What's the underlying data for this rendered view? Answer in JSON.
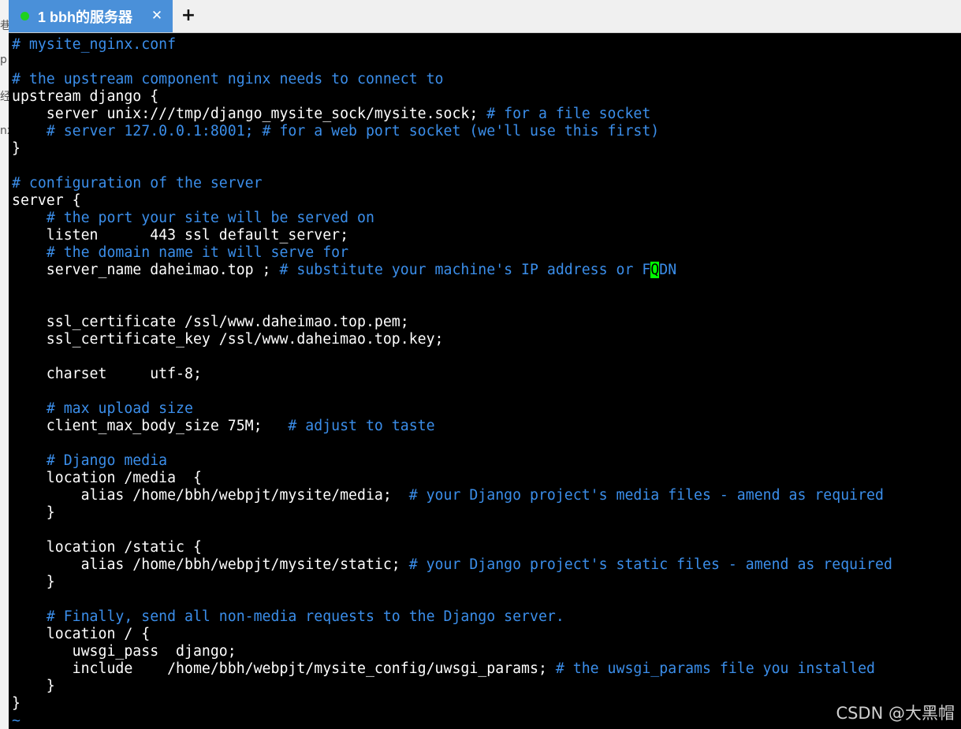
{
  "window": {
    "tab": {
      "label": "1 bbh的服务器",
      "status_color": "#1fd11f",
      "close_icon": "close-icon"
    },
    "new_tab_label": "+"
  },
  "terminal": {
    "lines": [
      {
        "code": "",
        "comment": "# mysite_nginx.conf"
      },
      {
        "code": "",
        "comment": ""
      },
      {
        "code": "",
        "comment": "# the upstream component nginx needs to connect to"
      },
      {
        "code": "upstream django {",
        "comment": ""
      },
      {
        "code": "    server unix:///tmp/django_mysite_sock/mysite.sock; ",
        "comment": "# for a file socket"
      },
      {
        "code": "    ",
        "comment": "# server 127.0.0.1:8001; # for a web port socket (we'll use this first)"
      },
      {
        "code": "}",
        "comment": ""
      },
      {
        "code": "",
        "comment": ""
      },
      {
        "code": "",
        "comment": "# configuration of the server"
      },
      {
        "code": "server {",
        "comment": ""
      },
      {
        "code": "    ",
        "comment": "# the port your site will be served on"
      },
      {
        "code": "    listen      443 ssl default_server;",
        "comment": ""
      },
      {
        "code": "    ",
        "comment": "# the domain name it will serve for"
      },
      {
        "code": "    server_name daheimao.top ; ",
        "comment": "# substitute your machine's IP address or F",
        "cursor": "Q",
        "comment_after": "DN"
      },
      {
        "code": "",
        "comment": ""
      },
      {
        "code": "",
        "comment": ""
      },
      {
        "code": "    ssl_certificate /ssl/www.daheimao.top.pem;",
        "comment": ""
      },
      {
        "code": "    ssl_certificate_key /ssl/www.daheimao.top.key;",
        "comment": ""
      },
      {
        "code": "",
        "comment": ""
      },
      {
        "code": "    charset     utf-8;",
        "comment": ""
      },
      {
        "code": "",
        "comment": ""
      },
      {
        "code": "    ",
        "comment": "# max upload size"
      },
      {
        "code": "    client_max_body_size 75M;   ",
        "comment": "# adjust to taste"
      },
      {
        "code": "",
        "comment": ""
      },
      {
        "code": "    ",
        "comment": "# Django media"
      },
      {
        "code": "    location /media  {",
        "comment": ""
      },
      {
        "code": "        alias /home/bbh/webpjt/mysite/media;  ",
        "comment": "# your Django project's media files - amend as required"
      },
      {
        "code": "    }",
        "comment": ""
      },
      {
        "code": "",
        "comment": ""
      },
      {
        "code": "    location /static {",
        "comment": ""
      },
      {
        "code": "        alias /home/bbh/webpjt/mysite/static; ",
        "comment": "# your Django project's static files - amend as required"
      },
      {
        "code": "    }",
        "comment": ""
      },
      {
        "code": "",
        "comment": ""
      },
      {
        "code": "    ",
        "comment": "# Finally, send all non-media requests to the Django server."
      },
      {
        "code": "    location / {",
        "comment": ""
      },
      {
        "code": "       uwsgi_pass  django;",
        "comment": ""
      },
      {
        "code": "       include    /home/bbh/webpjt/mysite_config/uwsgi_params; ",
        "comment": "# the uwsgi_params file you installed"
      },
      {
        "code": "    }",
        "comment": ""
      },
      {
        "code": "}",
        "comment": ""
      }
    ],
    "tilde": "~",
    "comment_color": "#3b8eea",
    "cursor_color": "#00ff00"
  },
  "watermark": "CSDN @大黑帽"
}
